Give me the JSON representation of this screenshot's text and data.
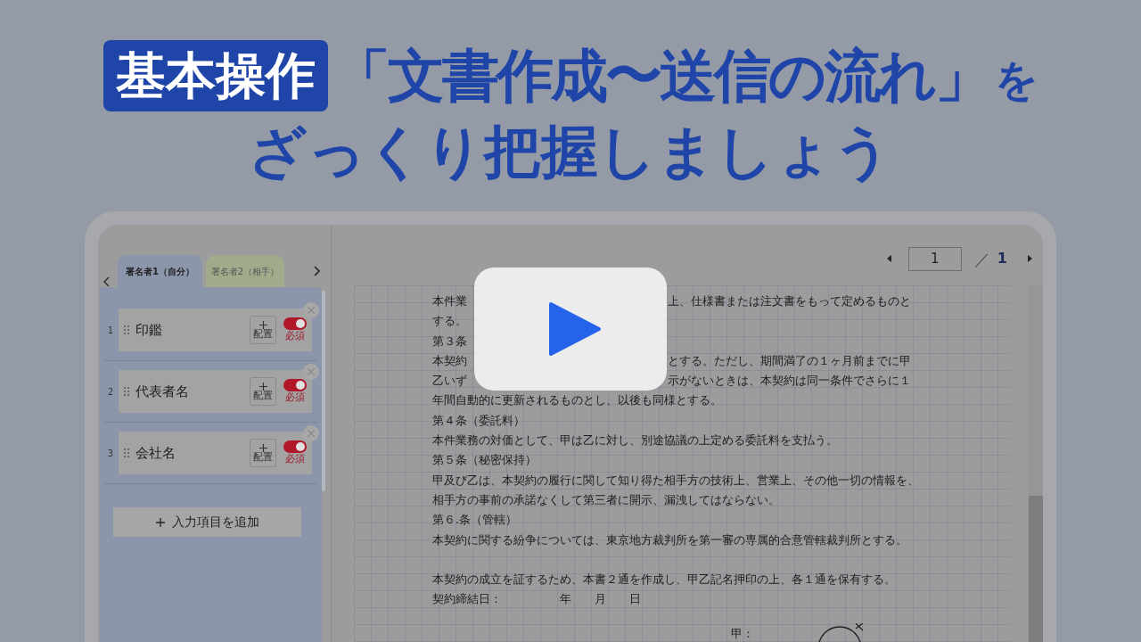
{
  "headline": {
    "badge": "基本操作",
    "title": "「文書作成〜送信の流れ」",
    "suffix": "を",
    "subtitle": "ざっくり把握しましょう"
  },
  "signer_tabs": [
    {
      "label": "署名者1（自分）",
      "selected": true,
      "color": "#8c96aa"
    },
    {
      "label": "署名者2（相手）",
      "selected": false,
      "color": "#a2aa8c"
    }
  ],
  "fields": [
    {
      "number": "1",
      "label": "印鑑",
      "place_label": "配置",
      "required": true,
      "required_label": "必須"
    },
    {
      "number": "2",
      "label": "代表者名",
      "place_label": "配置",
      "required": true,
      "required_label": "必須"
    },
    {
      "number": "3",
      "label": "会社名",
      "place_label": "配置",
      "required": true,
      "required_label": "必須"
    }
  ],
  "add_button": "入力項目を追加",
  "pager": {
    "page": "1",
    "separator": "／",
    "total": "1"
  },
  "document": {
    "paragraphs": [
      [
        {
          "kind": "covered",
          "before": "本件業",
          "after": "上、仕様書または注文書をもって定めるものと"
        },
        {
          "kind": "plain",
          "text": "する。"
        },
        {
          "kind": "covered",
          "before": "第３条"
        },
        {
          "kind": "covered",
          "before": "本契約",
          "after": "とする。ただし、期間満了の１ヶ月前までに甲"
        },
        {
          "kind": "covered",
          "before": "乙いず",
          "after": "示がないときは、本契約は同一条件でさらに１"
        },
        {
          "kind": "plain",
          "text": "年間自動的に更新されるものとし、以後も同様とする。"
        },
        {
          "kind": "plain",
          "text": "第４条（委託料）"
        },
        {
          "kind": "plain",
          "text": "本件業務の対価として、甲は乙に対し、別途協議の上定める委託料を支払う。"
        },
        {
          "kind": "plain",
          "text": "第５条（秘密保持）"
        },
        {
          "kind": "plain",
          "text": "甲及び乙は、本契約の履行に関して知り得た相手方の技術上、営業上、その他一切の情報を、"
        },
        {
          "kind": "plain",
          "text": "相手方の事前の承諾なくして第三者に開示、漏洩してはならない。"
        },
        {
          "kind": "plain",
          "text": "第６.条（管轄）"
        },
        {
          "kind": "plain",
          "text": "本契約に関する紛争については、東京地方裁判所を第一審の専属的合意管轄裁判所とする。"
        }
      ],
      [
        {
          "kind": "plain",
          "text": "本契約の成立を証するため、本書２通を作成し、甲乙記名押印の上、各１通を保有する。"
        },
        {
          "kind": "plain",
          "text": "契約締結日：　　　　　年　　月　　日"
        }
      ]
    ],
    "signature_label": "甲："
  }
}
